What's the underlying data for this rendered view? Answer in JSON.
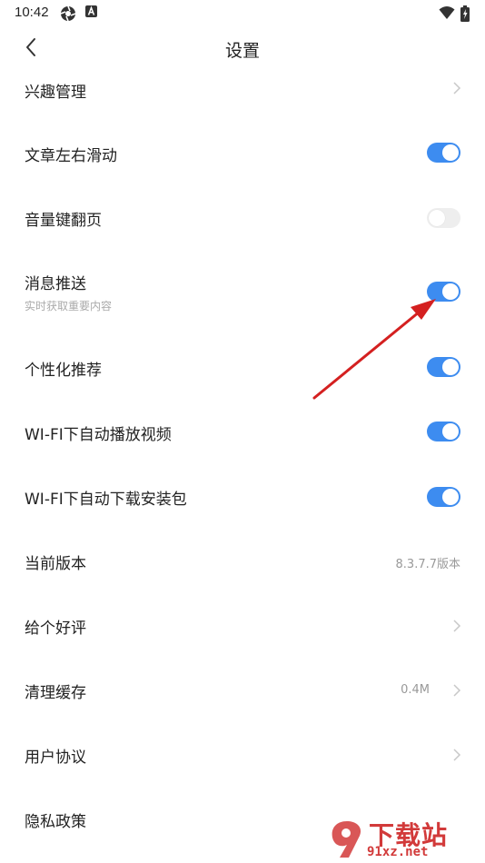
{
  "status_bar": {
    "time": "10:42",
    "icons": [
      "aperture-icon",
      "notification-a-icon",
      "wifi-icon",
      "battery-charging-icon"
    ]
  },
  "header": {
    "title": "设置",
    "back_icon": "chevron-left-icon"
  },
  "settings": {
    "interest": {
      "label": "兴趣管理"
    },
    "swipe": {
      "label": "文章左右滑动",
      "enabled": true
    },
    "volume_key": {
      "label": "音量键翻页",
      "enabled": false
    },
    "push": {
      "label": "消息推送",
      "sublabel": "实时获取重要内容",
      "enabled": true
    },
    "personalized": {
      "label": "个性化推荐",
      "enabled": true
    },
    "wifi_video": {
      "label": "WI-FI下自动播放视频",
      "enabled": true
    },
    "wifi_download": {
      "label": "WI-FI下自动下载安装包",
      "enabled": true
    },
    "version": {
      "label": "当前版本",
      "value": "8.3.7.7版本"
    },
    "rate": {
      "label": "给个好评"
    },
    "cache": {
      "label": "清理缓存",
      "value": "0.4M"
    },
    "agreement": {
      "label": "用户协议"
    },
    "privacy": {
      "label": "隐私政策"
    }
  },
  "watermark": {
    "text": "下载站",
    "url": "91xz.net"
  },
  "colors": {
    "accent": "#3d8cf0",
    "toggle_off": "#eeeeee",
    "annotation_arrow": "#d42020",
    "watermark": "#d23a3a"
  }
}
